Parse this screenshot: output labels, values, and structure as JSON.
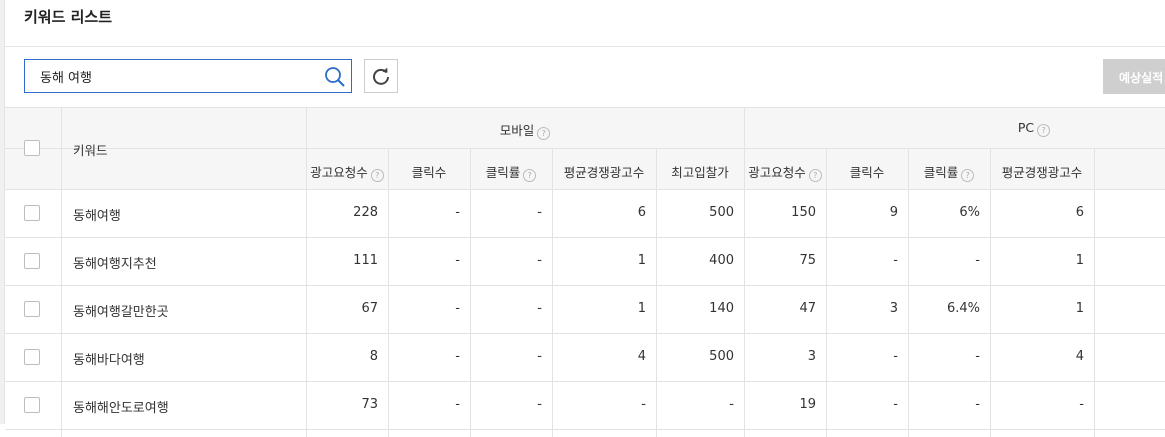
{
  "page": {
    "title": "키워드 리스트"
  },
  "search": {
    "value": "동해 여행"
  },
  "actions": {
    "estimate_label": "예상실적"
  },
  "table": {
    "group_headers": {
      "keyword": "키워드",
      "mobile": "모바일",
      "pc": "PC"
    },
    "sub_headers": [
      "광고요청수",
      "클릭수",
      "클릭률",
      "평균경쟁광고수",
      "최고입찰가",
      "광고요청수",
      "클릭수",
      "클릭률",
      "평균경쟁광고수"
    ],
    "help_glyph": "?",
    "rows": [
      {
        "keyword": "동해여행",
        "cells": [
          "228",
          "-",
          "-",
          "6",
          "500",
          "150",
          "9",
          "6%",
          "6"
        ]
      },
      {
        "keyword": "동해여행지추천",
        "cells": [
          "111",
          "-",
          "-",
          "1",
          "400",
          "75",
          "-",
          "-",
          "1"
        ]
      },
      {
        "keyword": "동해여행갈만한곳",
        "cells": [
          "67",
          "-",
          "-",
          "1",
          "140",
          "47",
          "3",
          "6.4%",
          "1"
        ]
      },
      {
        "keyword": "동해바다여행",
        "cells": [
          "8",
          "-",
          "-",
          "4",
          "500",
          "3",
          "-",
          "-",
          "4"
        ]
      },
      {
        "keyword": "동해해안도로여행",
        "cells": [
          "73",
          "-",
          "-",
          "-",
          "-",
          "19",
          "-",
          "-",
          "-"
        ]
      }
    ]
  },
  "icons": {
    "search": "search-icon",
    "refresh": "refresh-icon",
    "help": "help-icon"
  },
  "colors": {
    "accent": "#2a6cc9",
    "header_bg": "#f6f6f6",
    "disabled_button": "#cfcfcf"
  }
}
